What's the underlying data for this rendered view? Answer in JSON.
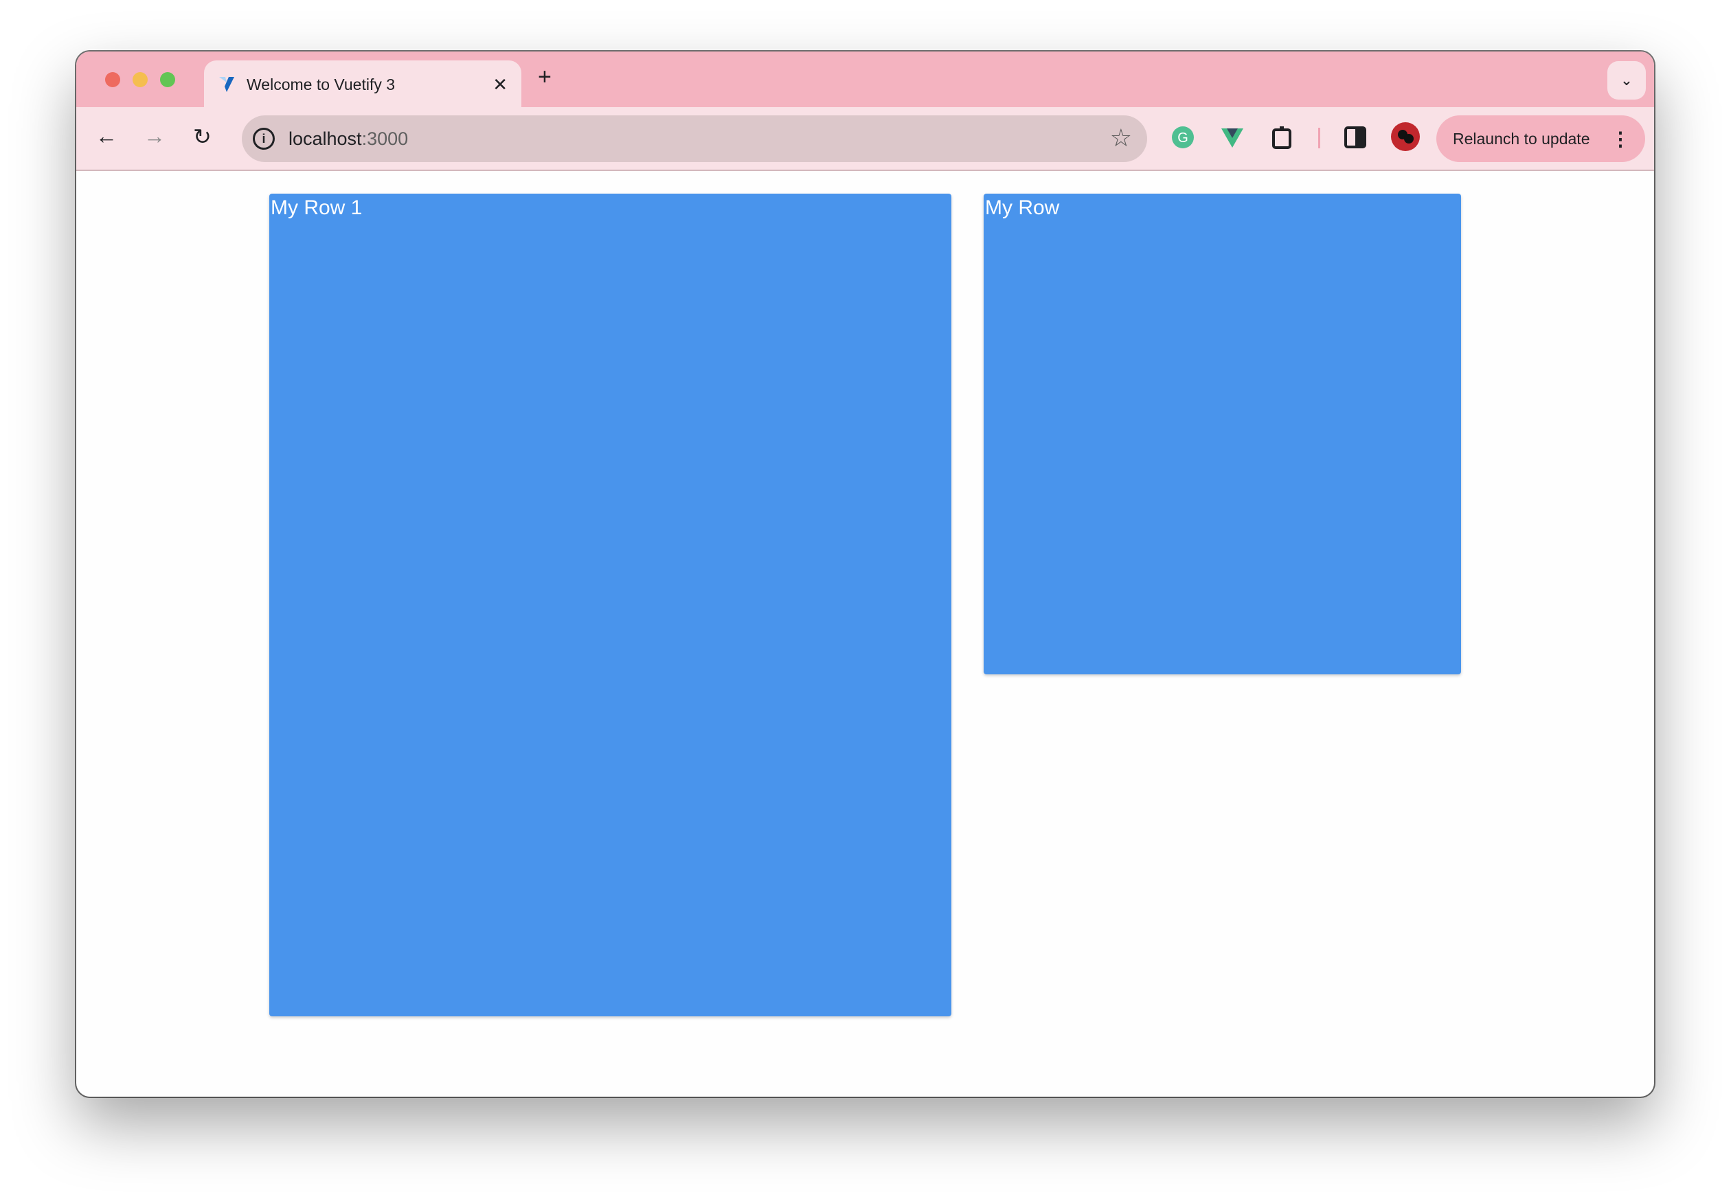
{
  "browser": {
    "tab_title": "Welcome to Vuetify 3",
    "url_host": "localhost",
    "url_port": ":3000",
    "relaunch_label": "Relaunch to update",
    "colors": {
      "tabbar": "#f4b3c0",
      "toolbar": "#f9e1e6",
      "card": "#4994ec"
    }
  },
  "page": {
    "cards": [
      {
        "label": "My Row 1"
      },
      {
        "label": "My Row"
      }
    ]
  }
}
